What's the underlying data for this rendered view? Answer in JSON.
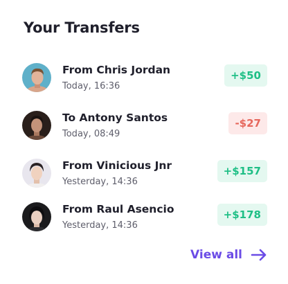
{
  "header": {
    "title": "Your Transfers"
  },
  "transfers": [
    {
      "name": "From Chris Jordan",
      "time": "Today, 16:36",
      "amount": "+$50",
      "type": "incoming",
      "avatar": "avatar-icon"
    },
    {
      "name": "To Antony Santos",
      "time": "Today, 08:49",
      "amount": "-$27",
      "type": "outgoing",
      "avatar": "avatar-icon"
    },
    {
      "name": "From Vinicious Jnr",
      "time": "Yesterday, 14:36",
      "amount": "+$157",
      "type": "incoming",
      "avatar": "avatar-icon"
    },
    {
      "name": "From Raul Asencio",
      "time": "Yesterday, 14:36",
      "amount": "+$178",
      "type": "incoming",
      "avatar": "avatar-icon"
    }
  ],
  "footer": {
    "view_all_label": "View all",
    "view_all_icon": "arrow-right-icon"
  },
  "colors": {
    "accent": "#6b4ce6",
    "positive": "#1fbf86",
    "positive_bg": "#e4f8f0",
    "negative": "#e6675c",
    "negative_bg": "#fde9e9",
    "text_primary": "#1f1f2b",
    "text_secondary": "#5e5e6b"
  }
}
